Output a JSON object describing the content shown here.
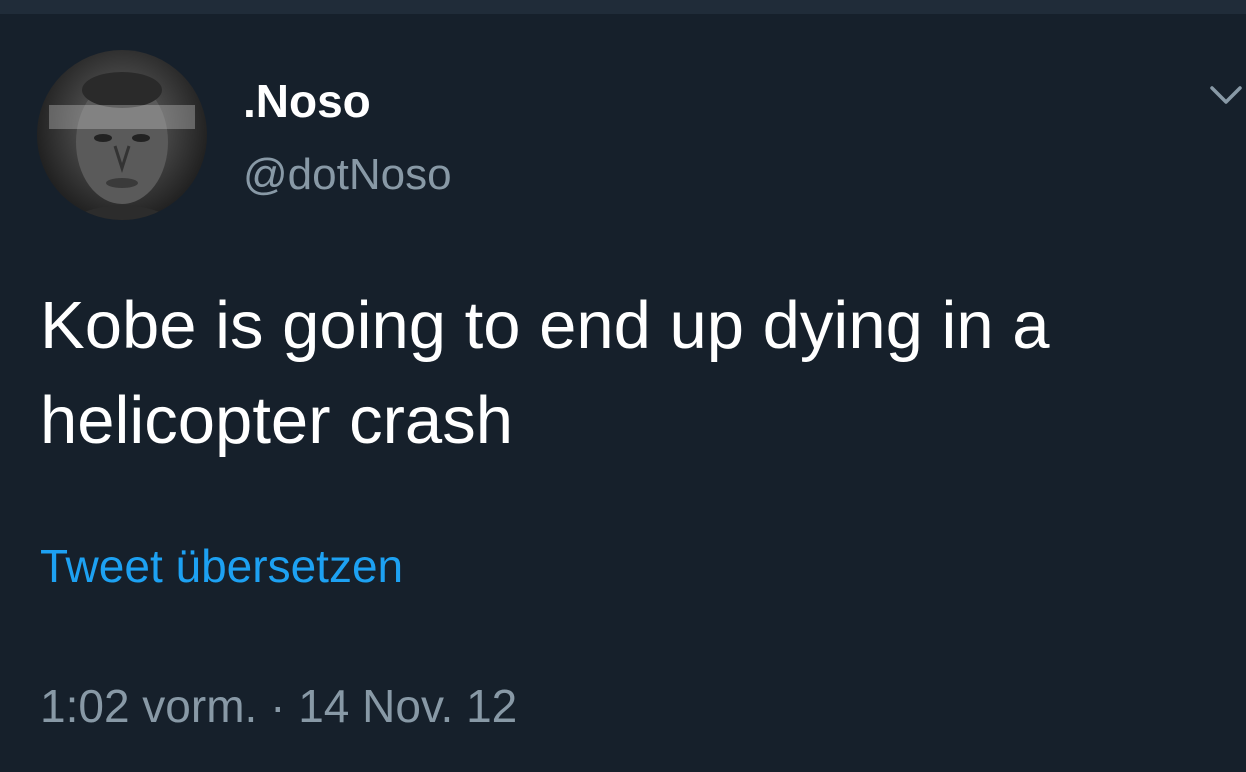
{
  "tweet": {
    "display_name": ".Noso",
    "handle": "@dotNoso",
    "text": "Kobe is going to end up dying in a\nhelicopter crash",
    "translate_label": "Tweet übersetzen",
    "timestamp": "1:02 vorm. · 14 Nov. 12"
  },
  "icons": {
    "avatar": "profile-photo",
    "menu": "chevron-down-icon"
  },
  "colors": {
    "background": "#16202b",
    "primary_text": "#ffffff",
    "secondary_text": "#8899a6",
    "link": "#1da1f2"
  }
}
